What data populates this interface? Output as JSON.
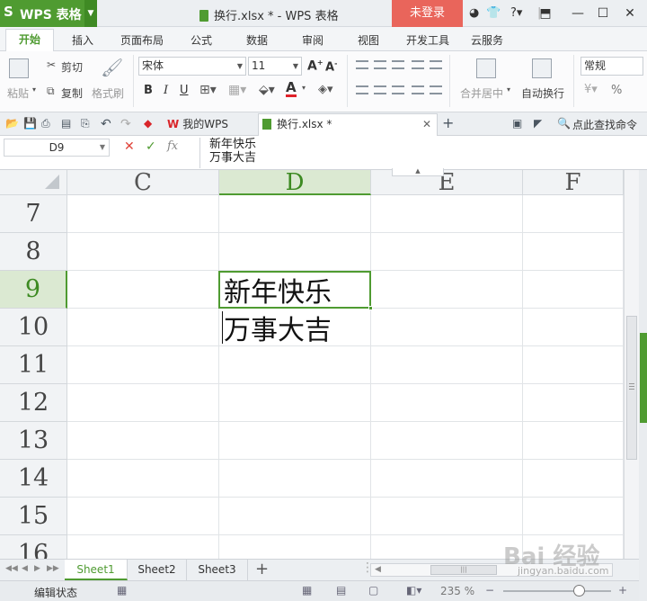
{
  "app": {
    "name": "WPS 表格",
    "logo_letter": "S"
  },
  "window": {
    "title": "换行.xlsx * - WPS 表格",
    "login_label": "未登录"
  },
  "ribbon_tabs": [
    "开始",
    "插入",
    "页面布局",
    "公式",
    "数据",
    "审阅",
    "视图",
    "开发工具",
    "云服务"
  ],
  "ribbon": {
    "paste": "粘贴",
    "cut": "剪切",
    "copy": "复制",
    "format_painter": "格式刷",
    "font_name": "宋体",
    "font_size": "11",
    "bold": "B",
    "italic": "I",
    "underline": "U",
    "merge_center": "合并居中",
    "wrap_text": "自动换行",
    "number_format": "常规",
    "percent": "%"
  },
  "doc_tabs": {
    "wps": "我的WPS",
    "file": "换行.xlsx *",
    "find_command": "点此查找命令"
  },
  "formula_bar": {
    "name_box": "D9",
    "fx": "fx",
    "line1": "新年快乐",
    "line2": "万事大吉"
  },
  "grid": {
    "columns": [
      "C",
      "D",
      "E",
      "F"
    ],
    "selected_column": "D",
    "rows": [
      "7",
      "8",
      "9",
      "10",
      "11",
      "12",
      "13",
      "14",
      "15",
      "16"
    ],
    "selected_row": "9",
    "active_cell": {
      "ref": "D9",
      "line1": "新年快乐",
      "line2": "万事大吉"
    }
  },
  "sheets": [
    "Sheet1",
    "Sheet2",
    "Sheet3"
  ],
  "active_sheet": "Sheet1",
  "status": {
    "mode": "编辑状态",
    "zoom": "235 %"
  },
  "watermark": {
    "text": "Bai 经验",
    "url": "jingyan.baidu.com"
  },
  "colors": {
    "brand_green": "#4f9b31",
    "login_red": "#e9655b",
    "font_color_red": "#e0222a"
  }
}
